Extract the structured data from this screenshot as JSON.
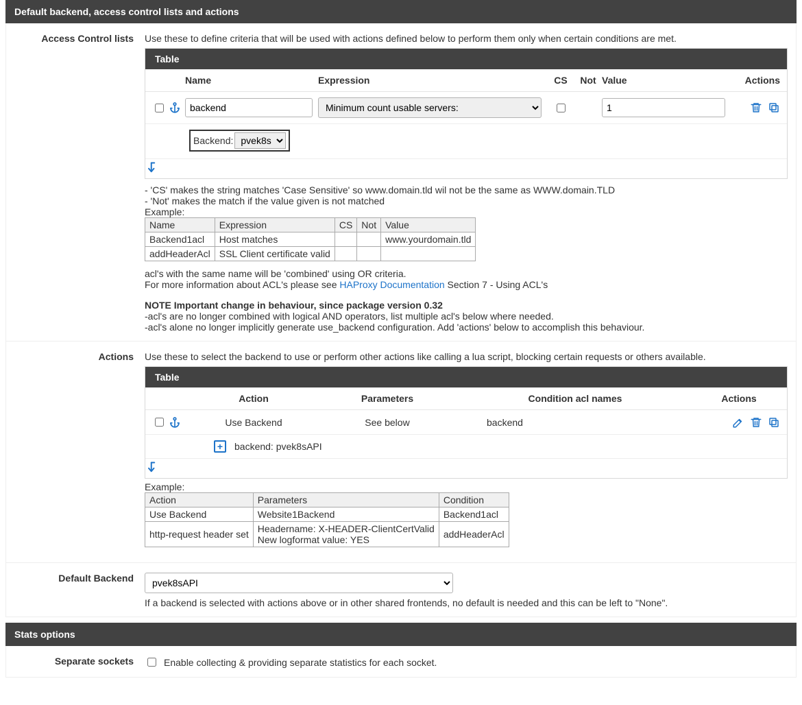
{
  "panel1": {
    "title": "Default backend, access control lists and actions"
  },
  "acl": {
    "label": "Access Control lists",
    "desc": "Use these to define criteria that will be used with actions defined below to perform them only when certain conditions are met.",
    "table_label": "Table",
    "headers": {
      "name": "Name",
      "expr": "Expression",
      "cs": "CS",
      "not": "Not",
      "value": "Value",
      "actions": "Actions"
    },
    "row": {
      "name_value": "backend",
      "expr_value": "Minimum count usable servers:",
      "value_value": "1"
    },
    "subrow": {
      "backend_label": "Backend:",
      "backend_value": "pvek8s"
    },
    "notes_cs": "- 'CS' makes the string matches 'Case Sensitive' so www.domain.tld wil not be the same as WWW.domain.TLD",
    "notes_not": "- 'Not' makes the match if the value given is not matched",
    "example_label": "Example:",
    "example_headers": {
      "name": "Name",
      "expr": "Expression",
      "cs": "CS",
      "not": "Not",
      "value": "Value"
    },
    "example_rows": [
      {
        "name": "Backend1acl",
        "expr": "Host matches",
        "cs": "",
        "not": "",
        "value": "www.yourdomain.tld"
      },
      {
        "name": "addHeaderAcl",
        "expr": "SSL Client certificate valid",
        "cs": "",
        "not": "",
        "value": ""
      }
    ],
    "combine_note": "acl's with the same name will be 'combined' using OR criteria.",
    "doc_pre": "For more information about ACL's please see ",
    "doc_link": "HAProxy Documentation",
    "doc_post": " Section 7 - Using ACL's",
    "change_title": "NOTE Important change in behaviour, since package version 0.32",
    "change_l1": "-acl's are no longer combined with logical AND operators, list multiple acl's below where needed.",
    "change_l2": "-acl's alone no longer implicitly generate use_backend configuration. Add 'actions' below to accomplish this behaviour."
  },
  "actions": {
    "label": "Actions",
    "desc": "Use these to select the backend to use or perform other actions like calling a lua script, blocking certain requests or others available.",
    "table_label": "Table",
    "headers": {
      "action": "Action",
      "params": "Parameters",
      "cond": "Condition acl names",
      "acts": "Actions"
    },
    "row": {
      "action": "Use Backend",
      "params": "See below",
      "cond": "backend"
    },
    "subrow": {
      "text": "backend: pvek8sAPI"
    },
    "example_label": "Example:",
    "example_headers": {
      "action": "Action",
      "params": "Parameters",
      "cond": "Condition"
    },
    "example_rows": [
      {
        "action": "Use Backend",
        "params": "Website1Backend",
        "cond": "Backend1acl"
      },
      {
        "action": "http-request header set",
        "params": "Headername: X-HEADER-ClientCertValid\nNew logformat value: YES",
        "cond": "addHeaderAcl"
      }
    ]
  },
  "default_backend": {
    "label": "Default Backend",
    "value": "pvek8sAPI",
    "help": "If a backend is selected with actions above or in other shared frontends, no default is needed and this can be left to \"None\"."
  },
  "panel2": {
    "title": "Stats options"
  },
  "stats": {
    "label": "Separate sockets",
    "checkbox_label": "Enable collecting & providing separate statistics for each socket."
  }
}
